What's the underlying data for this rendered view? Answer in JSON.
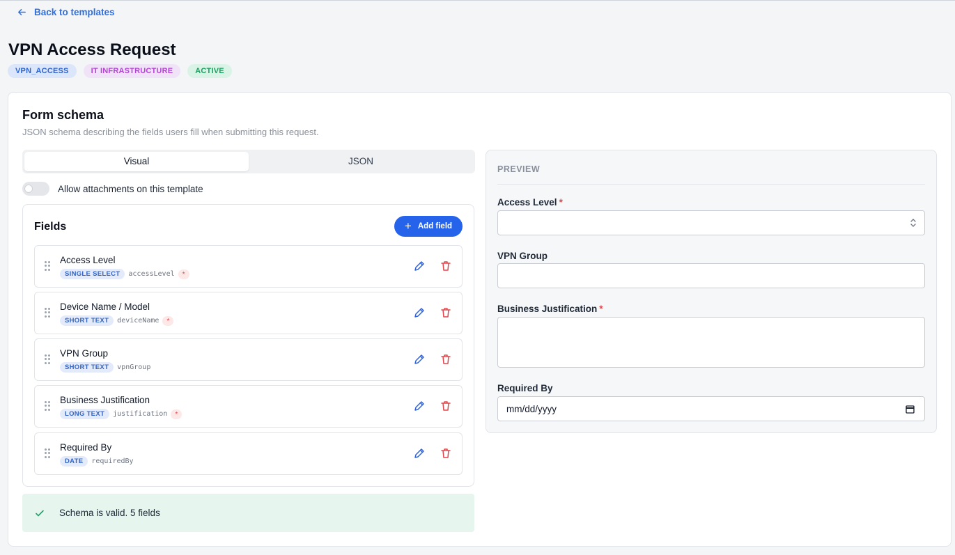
{
  "nav": {
    "back_label": "Back to templates"
  },
  "template": {
    "title": "VPN Access Request",
    "badges": [
      {
        "label": "VPN_ACCESS",
        "color": "#2d64cf"
      },
      {
        "label": "IT INFRASTRUCTURE",
        "color": "#b543d6"
      },
      {
        "label": "ACTIVE",
        "color": "#18a05f"
      }
    ]
  },
  "schema": {
    "title": "Form schema",
    "subtitle": "JSON schema describing the fields users fill when submitting this request.",
    "tabs": [
      {
        "label": "Visual",
        "active": true
      },
      {
        "label": "JSON",
        "active": false
      }
    ],
    "attachments_toggle": {
      "label": "Allow attachments on this template",
      "on": false
    },
    "fields_title": "Fields",
    "add_field_label": "Add field",
    "fields": [
      {
        "name": "Access Level",
        "type": "SINGLE SELECT",
        "key": "accessLevel",
        "required": true,
        "required_mark": "*"
      },
      {
        "name": "Device Name / Model",
        "type": "SHORT TEXT",
        "key": "deviceName",
        "required": true,
        "required_mark": "*"
      },
      {
        "name": "VPN Group",
        "type": "SHORT TEXT",
        "key": "vpnGroup",
        "required": false,
        "required_mark": ""
      },
      {
        "name": "Business Justification",
        "type": "LONG TEXT",
        "key": "justification",
        "required": true,
        "required_mark": "*"
      },
      {
        "name": "Required By",
        "type": "DATE",
        "key": "requiredBy",
        "required": false,
        "required_mark": ""
      }
    ],
    "validation_message": "Schema is valid. 5 fields"
  },
  "preview": {
    "label": "PREVIEW",
    "fields": [
      {
        "label": "Access Level",
        "required_mark": "*",
        "value": ""
      },
      {
        "label": "VPN Group",
        "required_mark": "",
        "value": ""
      },
      {
        "label": "Business Justification",
        "required_mark": "*",
        "value": ""
      },
      {
        "label": "Required By",
        "required_mark": "",
        "value": "mm/dd/yyyy"
      }
    ]
  },
  "colors": {
    "accent": "#2563eb",
    "required": "#e0484d",
    "valid_bg": "#e6f6ee",
    "valid_check": "#22a06b"
  }
}
